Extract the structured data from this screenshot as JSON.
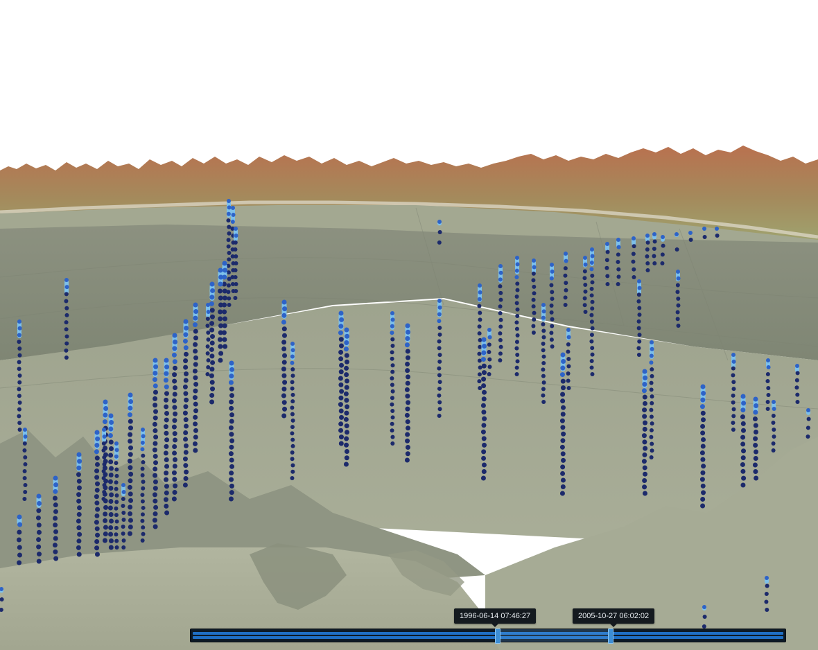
{
  "viewer": {
    "background_color": "#ffffff",
    "surface_color": "#a9ad95",
    "mountain_color": "#b57a5a",
    "marker_colors": {
      "deep": "#1c2a6b",
      "mid": "#2d63c8",
      "shallow": "#7ec0ea"
    }
  },
  "timeline": {
    "start_label": "1996-06-14 07:46:27",
    "end_label": "2005-10-27 06:02:02",
    "track_color": "#1f6fc4",
    "start_fraction": 0.515,
    "end_fraction": 0.705
  }
}
